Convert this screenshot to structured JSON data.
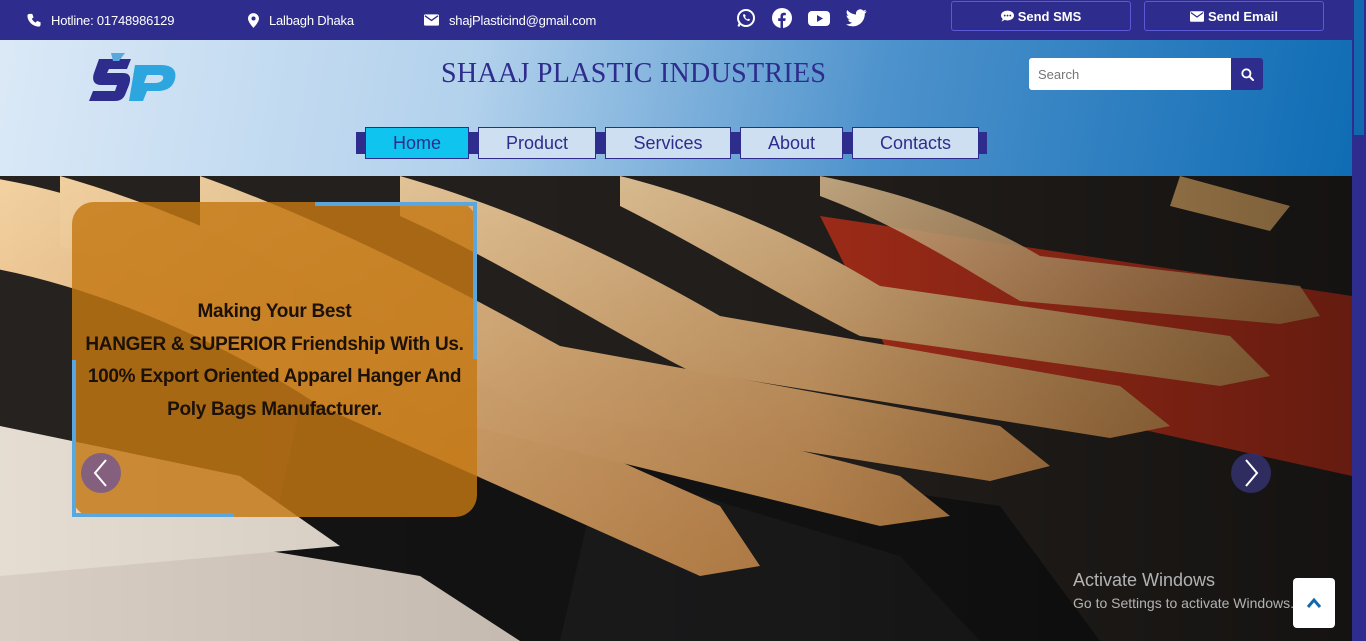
{
  "topbar": {
    "hotline": "Hotline: 01748986129",
    "location": "Lalbagh Dhaka",
    "email": "shajPlasticind@gmail.com",
    "social_icons": [
      "whatsapp-icon",
      "facebook-icon",
      "youtube-icon",
      "twitter-icon"
    ],
    "send_sms_label": "Send SMS",
    "send_email_label": "Send Email"
  },
  "header": {
    "logo_text": "SP",
    "site_title": "SHAAJ PLASTIC INDUSTRIES",
    "search_placeholder": "Search"
  },
  "nav": {
    "items": [
      {
        "label": "Home",
        "active": true
      },
      {
        "label": "Product",
        "active": false
      },
      {
        "label": "Services",
        "active": false
      },
      {
        "label": "About",
        "active": false
      },
      {
        "label": "Contacts",
        "active": false
      }
    ]
  },
  "hero": {
    "caption_lines": [
      "Making Your Best",
      "HANGER & SUPERIOR Friendship With Us.",
      "100% Export Oriented Apparel Hanger And",
      "Poly Bags Manufacturer."
    ]
  },
  "watermark": {
    "title": "Activate Windows",
    "subtitle": "Go to Settings to activate Windows."
  },
  "colors": {
    "brand": "#2e2c8c",
    "accent": "#0fc4ef",
    "caption_bg": "#c47812",
    "frame": "#5aa7dd"
  }
}
